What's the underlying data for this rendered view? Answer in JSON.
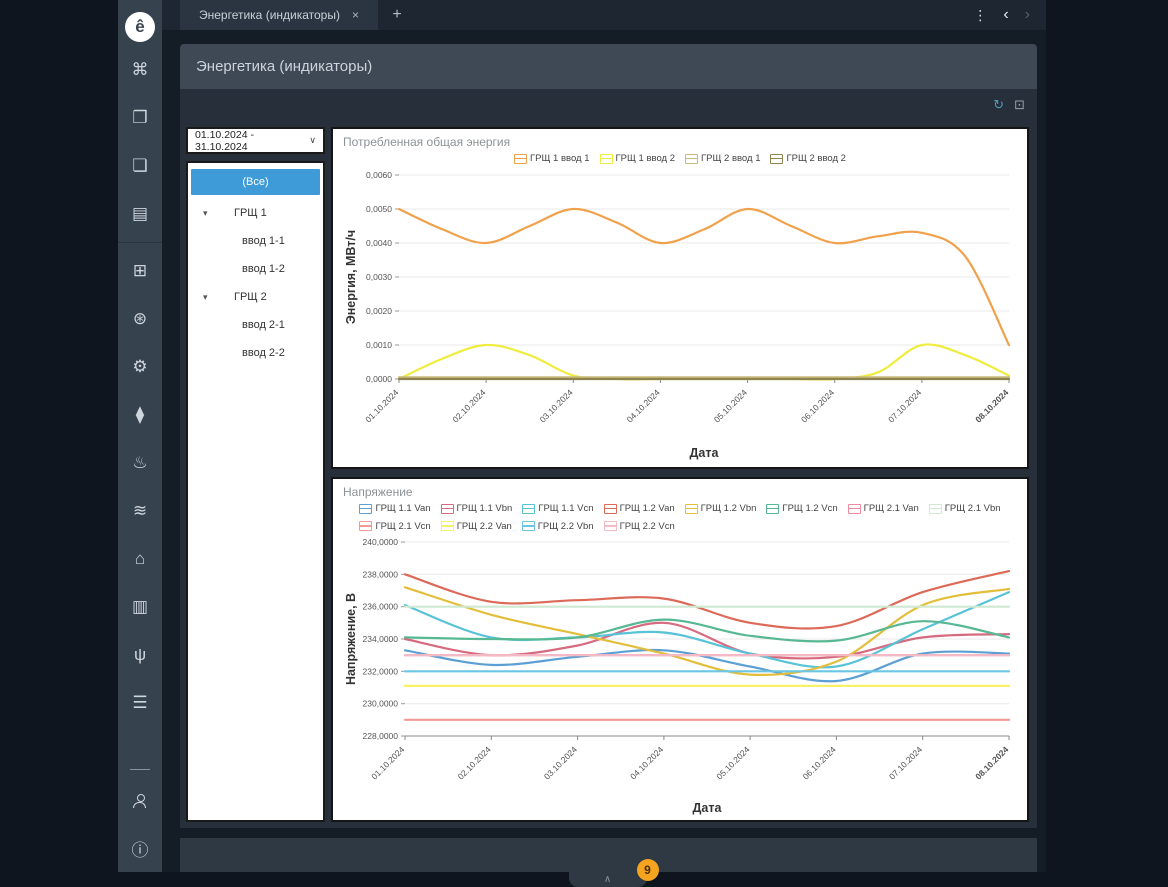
{
  "window": {
    "tab_title": "Энергетика (индикаторы)",
    "tab_close_icon": "×",
    "new_tab_icon": "+",
    "menu_icon": "⋮",
    "nav_back_icon": "‹",
    "nav_forward_icon": "›"
  },
  "sidebar": {
    "icons": [
      {
        "name": "logo",
        "glyph": "ê"
      },
      {
        "name": "hierarchy-icon",
        "glyph": "⌘"
      },
      {
        "name": "document-icon",
        "glyph": "❐"
      },
      {
        "name": "document-user-icon",
        "glyph": "❏"
      },
      {
        "name": "report-icon",
        "glyph": "▤"
      },
      {
        "divider": "full"
      },
      {
        "name": "apps-grid-icon",
        "glyph": "⊞"
      },
      {
        "name": "fan-icon",
        "glyph": "⊛"
      },
      {
        "name": "document-gear-icon",
        "glyph": "⚙"
      },
      {
        "name": "water-drop-icon",
        "glyph": "⧫"
      },
      {
        "name": "temperature-icon",
        "glyph": "♨"
      },
      {
        "name": "pipeline-icon",
        "glyph": "≋"
      },
      {
        "name": "building-icon",
        "glyph": "⌂"
      },
      {
        "name": "elevator-icon",
        "glyph": "▥"
      },
      {
        "name": "branch-icon",
        "glyph": "ψ"
      },
      {
        "name": "ventilation-unit-icon",
        "glyph": "☰"
      },
      {
        "divider": "short"
      },
      {
        "name": "user-icon",
        "shape": "person"
      },
      {
        "name": "info-icon",
        "glyph": "ⓘ"
      }
    ]
  },
  "page": {
    "title": "Энергетика (индикаторы)",
    "refresh_icon": "↻",
    "display_icon": "⊡",
    "collapse_icon": "∧",
    "bottom_badge": "9",
    "badge_color": "#f5a41f"
  },
  "filter": {
    "date_range": "01.10.2024 - 31.10.2024",
    "caret_icon": "∨",
    "selected_color": "#3e9bd8",
    "tree": [
      {
        "label": "(Все)",
        "level": 0,
        "selected": true
      },
      {
        "label": "ГРЩ 1",
        "level": 1,
        "expander": "▾"
      },
      {
        "label": "ввод 1-1",
        "level": 2
      },
      {
        "label": "ввод 1-2",
        "level": 2
      },
      {
        "label": "ГРЩ 2",
        "level": 1,
        "expander": "▾"
      },
      {
        "label": "ввод 2-1",
        "level": 2
      },
      {
        "label": "ввод 2-2",
        "level": 2
      }
    ]
  },
  "chart_data": [
    {
      "type": "line",
      "title": "Потребленная общая энергия",
      "xlabel": "Дата",
      "ylabel": "Энергия, МВт/ч",
      "ylim": [
        0,
        0.006
      ],
      "x_domain": [
        1,
        8
      ],
      "grid": true,
      "legend_position": "top",
      "y_ticks": [
        0,
        0.001,
        0.002,
        0.003,
        0.004,
        0.005,
        0.006
      ],
      "y_tick_labels": [
        "0,0000",
        "0,0010",
        "0,0020",
        "0,0030",
        "0,0040",
        "0,0050",
        "0,0060"
      ],
      "x_tick_labels": [
        "01.10.2024",
        "02.10.2024",
        "03.10.2024",
        "04.10.2024",
        "05.10.2024",
        "06.10.2024",
        "07.10.2024",
        "08.10.2024"
      ],
      "series": [
        {
          "name": "ГРЩ 1 ввод 1",
          "color": "#f0a14b",
          "x": [
            1,
            1.5,
            2,
            2.5,
            3,
            3.5,
            4,
            4.5,
            5,
            5.5,
            6,
            6.5,
            7,
            7.5,
            8
          ],
          "values": [
            0.005,
            0.0044,
            0.004,
            0.0045,
            0.005,
            0.0046,
            0.004,
            0.0044,
            0.005,
            0.0045,
            0.004,
            0.0042,
            0.0043,
            0.0036,
            0.001
          ]
        },
        {
          "name": "ГРЩ 1 ввод 2",
          "color": "#f0ec3d",
          "x": [
            1,
            1.5,
            2,
            2.5,
            3,
            3.5,
            4,
            4.5,
            5,
            5.5,
            6,
            6.5,
            7,
            7.5,
            8
          ],
          "values": [
            0,
            0.0006,
            0.001,
            0.0007,
            0.0001,
            0,
            0,
            0,
            0,
            0,
            0,
            0.0002,
            0.001,
            0.0007,
            0.0001
          ]
        },
        {
          "name": "ГРЩ 2 ввод 1",
          "color": "#c9b97a",
          "values": [
            5e-05,
            5e-05,
            5e-05,
            5e-05,
            5e-05,
            5e-05,
            5e-05,
            5e-05
          ]
        },
        {
          "name": "ГРЩ 2 ввод 2",
          "color": "#8d8450",
          "values": [
            0,
            0,
            0,
            0,
            0,
            0,
            0,
            0
          ]
        }
      ]
    },
    {
      "type": "line",
      "title": "Напряжение",
      "xlabel": "Дата",
      "ylabel": "Напряжение, В",
      "ylim": [
        228,
        240
      ],
      "x_domain": [
        1,
        8
      ],
      "grid": true,
      "legend_position": "top",
      "y_ticks": [
        228,
        230,
        232,
        234,
        236,
        238,
        240
      ],
      "y_tick_labels": [
        "228,0000",
        "230,0000",
        "232,0000",
        "234,0000",
        "236,0000",
        "238,0000",
        "240,0000"
      ],
      "x_tick_labels": [
        "01.10.2024",
        "02.10.2024",
        "03.10.2024",
        "04.10.2024",
        "05.10.2024",
        "06.10.2024",
        "07.10.2024",
        "08.10.2024"
      ],
      "series": [
        {
          "name": "ГРЩ 1.1 Van",
          "color": "#5b9fd4",
          "values": [
            233.3,
            232.4,
            232.9,
            233.3,
            232.3,
            231.4,
            233.1,
            233.1
          ]
        },
        {
          "name": "ГРЩ 1.1 Vbn",
          "color": "#d66a7e",
          "values": [
            234.0,
            233.0,
            233.6,
            235.0,
            233.1,
            232.9,
            234.1,
            234.3
          ]
        },
        {
          "name": "ГРЩ 1.1 Vcn",
          "color": "#58c2d8",
          "values": [
            236.1,
            234.1,
            234.1,
            234.4,
            233.1,
            232.3,
            234.6,
            236.9
          ]
        },
        {
          "name": "ГРЩ 1.2 Van",
          "color": "#dd6a58",
          "values": [
            238.0,
            236.3,
            236.4,
            236.5,
            235.0,
            234.8,
            236.9,
            238.2
          ]
        },
        {
          "name": "ГРЩ 1.2 Vbn",
          "color": "#e2be3a",
          "values": [
            237.2,
            235.5,
            234.3,
            233.1,
            231.8,
            232.6,
            236.1,
            237.1
          ]
        },
        {
          "name": "ГРЩ 1.2 Vcn",
          "color": "#57b893",
          "values": [
            234.1,
            234.0,
            234.1,
            235.2,
            234.2,
            233.9,
            235.1,
            234.1
          ]
        },
        {
          "name": "ГРЩ 2.1 Van",
          "color": "#f08aa0",
          "values": [
            233.0,
            233.0,
            233.0,
            233.0,
            233.0,
            233.0,
            233.0,
            233.0
          ]
        },
        {
          "name": "ГРЩ 2.1 Vbn",
          "color": "#cfe9d2",
          "values": [
            236.0,
            236.0,
            236.0,
            236.0,
            236.0,
            236.0,
            236.0,
            236.0
          ]
        },
        {
          "name": "ГРЩ 2.1 Vcn",
          "color": "#f29a93",
          "values": [
            229.0,
            229.0,
            229.0,
            229.0,
            229.0,
            229.0,
            229.0,
            229.0
          ]
        },
        {
          "name": "ГРЩ 2.2 Van",
          "color": "#f6f165",
          "values": [
            231.1,
            231.1,
            231.1,
            231.1,
            231.1,
            231.1,
            231.1,
            231.1
          ]
        },
        {
          "name": "ГРЩ 2.2 Vbn",
          "color": "#6ac6e4",
          "values": [
            232.0,
            232.0,
            232.0,
            232.0,
            232.0,
            232.0,
            232.0,
            232.0
          ]
        },
        {
          "name": "ГРЩ 2.2 Vcn",
          "color": "#f4bac6",
          "values": [
            233.0,
            233.0,
            233.0,
            233.0,
            233.0,
            233.0,
            233.0,
            233.0
          ]
        }
      ]
    }
  ]
}
